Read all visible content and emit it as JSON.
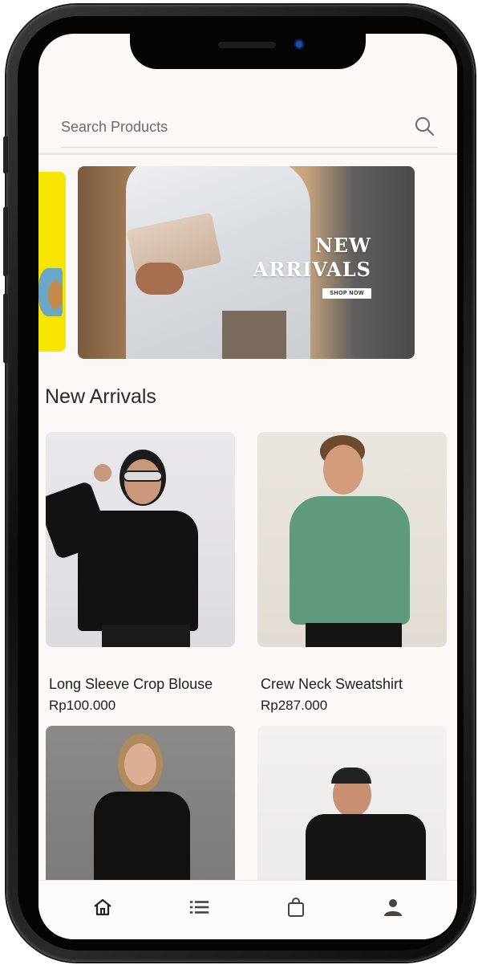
{
  "search": {
    "placeholder": "Search Products",
    "icon": "search-icon"
  },
  "banner": {
    "title_line1": "NEW",
    "title_line2": "ARRIVALS",
    "cta": "SHOP NOW"
  },
  "section": {
    "title": "New Arrivals"
  },
  "products": [
    {
      "name": "Long Sleeve Crop Blouse",
      "price": "Rp100.000"
    },
    {
      "name": "Crew Neck Sweatshirt",
      "price": "Rp287.000"
    },
    {
      "name": "",
      "price": ""
    },
    {
      "name": "",
      "price": ""
    }
  ],
  "nav": {
    "items": [
      {
        "icon": "home-icon"
      },
      {
        "icon": "list-icon"
      },
      {
        "icon": "shopping-bag-icon"
      },
      {
        "icon": "profile-icon"
      }
    ]
  },
  "colors": {
    "background": "#fbf8f6",
    "text": "#1f1f1f",
    "banner_prev": "#f7e400",
    "sweatshirt": "#5e9a7e"
  }
}
